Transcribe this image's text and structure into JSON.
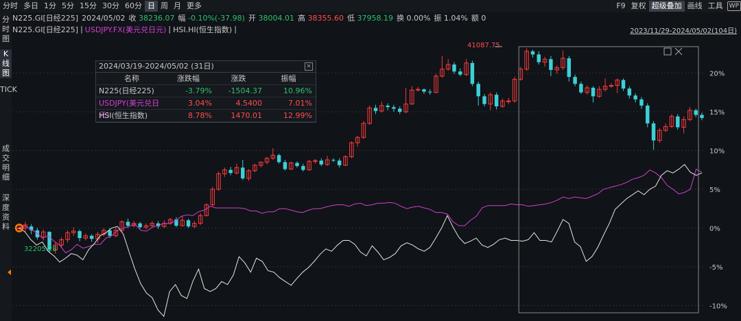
{
  "toolbar": {
    "periods": [
      "分时",
      "多日",
      "1分",
      "5分",
      "15分",
      "30分",
      "60分",
      "日",
      "周",
      "月",
      "更多"
    ],
    "active_period": "日",
    "tools": [
      "F9",
      "复权",
      "超级叠加",
      "画线",
      "工具"
    ],
    "active_tool": "超级叠加",
    "wp_label": "WP"
  },
  "quote": {
    "name": "N225.GI[日经225]",
    "date": "2024/05/02",
    "close_label": "收",
    "close": "38236.07",
    "change_label": "幅",
    "change": "-0.10%(-37.98)",
    "open_label": "开",
    "open": "38004.01",
    "high_label": "高",
    "high": "38355.60",
    "low_label": "低",
    "low": "37958.19",
    "turnover_label": "换",
    "turnover": "0.00%",
    "amplitude_label": "振",
    "amplitude": "1.04%",
    "amount_label": "额",
    "amount": "0"
  },
  "overlay": {
    "main": "N225.GI[日经225]",
    "sep1": "|",
    "usd": "USDJPY.FX(美元兑日元)",
    "sep2": "|",
    "hsi": "HSI.HI(恒生指数)",
    "sep3": "|",
    "range": "2023/11/29-2024/05/02(104日)"
  },
  "sidetabs": [
    "分时图",
    "K线图",
    "TICK",
    "成交明细",
    "深度资料"
  ],
  "active_sidetab": "K线图",
  "stats": {
    "title": "2024/03/19-2024/05/02 (31日)",
    "headers": [
      "名称",
      "涨跌幅",
      "涨跌",
      "振幅"
    ],
    "rows": [
      {
        "name": "N225(日经225)",
        "pct": "-3.79%",
        "chg": "-1504.37",
        "amp": "10.96%",
        "name_color": "#c8c8c8",
        "val_color": "#2dc26b"
      },
      {
        "name": "USDJPY(美元兑日元)",
        "pct": "3.04%",
        "chg": "4.5400",
        "amp": "7.01%",
        "name_color": "#d040d0",
        "val_color": "#ff4d4d"
      },
      {
        "name": "HSI(恒生指数)",
        "pct": "8.78%",
        "chg": "1470.01",
        "amp": "12.99%",
        "name_color": "#c8c8c8",
        "val_color": "#ff4d4d"
      }
    ]
  },
  "chart_data": {
    "type": "line",
    "annotations": {
      "high": "41087.75",
      "low": "32205.28"
    },
    "ylim": [
      -12,
      25
    ],
    "y_ticks": [
      -10,
      -5,
      0,
      5,
      10,
      15,
      20
    ],
    "y_tick_labels": [
      "-10%",
      "-5%",
      "0%",
      "5%",
      "10%",
      "15%",
      "20%"
    ],
    "candles": [
      [
        0,
        0,
        0.6,
        -0.4
      ],
      [
        0,
        0.4,
        0.8,
        -0.5
      ],
      [
        0.2,
        -0.3,
        0.5,
        -0.8
      ],
      [
        -0.3,
        -1.2,
        0,
        -1.5
      ],
      [
        -1.2,
        -0.5,
        -0.2,
        -1.6
      ],
      [
        -0.5,
        -2.8,
        -0.4,
        -3.2
      ],
      [
        -2.8,
        -2.2,
        -1.9,
        -3.3
      ],
      [
        -2.2,
        -1.5,
        -1.2,
        -2.6
      ],
      [
        -1.5,
        -0.6,
        -0.3,
        -1.9
      ],
      [
        -0.6,
        -0.4,
        0.1,
        -1.0
      ],
      [
        -0.4,
        -1.3,
        -0.2,
        -1.7
      ],
      [
        -1.3,
        -1.0,
        -0.7,
        -1.6
      ],
      [
        -1.0,
        -1.4,
        -0.8,
        -1.8
      ],
      [
        -1.4,
        -0.8,
        -0.5,
        -1.9
      ],
      [
        -0.8,
        -0.3,
        0,
        -1.1
      ],
      [
        -0.3,
        -1.0,
        0,
        -1.3
      ],
      [
        -1.0,
        -0.3,
        0.1,
        -1.2
      ],
      [
        -0.3,
        0.8,
        1.0,
        -0.5
      ],
      [
        0.8,
        0.3,
        1.2,
        0
      ],
      [
        0.3,
        0.6,
        0.9,
        0.1
      ],
      [
        0.6,
        0.1,
        0.8,
        -0.1
      ],
      [
        0.1,
        0.3,
        0.6,
        -0.2
      ],
      [
        0.3,
        0.6,
        0.9,
        0.1
      ],
      [
        0.6,
        0.2,
        0.9,
        -0.1
      ],
      [
        0.2,
        0.6,
        1.0,
        0
      ],
      [
        0.6,
        1.1,
        1.3,
        0.4
      ],
      [
        1.1,
        0.3,
        1.4,
        0.1
      ],
      [
        0.3,
        1.0,
        1.6,
        0.2
      ],
      [
        1.0,
        0.2,
        1.2,
        0
      ],
      [
        0.2,
        0.6,
        0.9,
        0
      ],
      [
        0.6,
        1.6,
        1.9,
        0.4
      ],
      [
        1.6,
        3.0,
        3.2,
        1.5
      ],
      [
        3.0,
        5.0,
        5.3,
        2.8
      ],
      [
        5.0,
        7.0,
        7.3,
        4.8
      ],
      [
        7.0,
        7.5,
        7.8,
        6.6
      ],
      [
        7.5,
        7.1,
        7.9,
        6.8
      ],
      [
        7.1,
        7.8,
        8.3,
        6.9
      ],
      [
        7.8,
        6.4,
        8.8,
        6.2
      ],
      [
        6.4,
        7.4,
        7.6,
        6.1
      ],
      [
        7.4,
        8.1,
        8.3,
        7.2
      ],
      [
        8.1,
        8.5,
        8.6,
        7.8
      ],
      [
        8.5,
        9.0,
        9.2,
        8.2
      ],
      [
        9.0,
        9.4,
        10.3,
        8.8
      ],
      [
        9.4,
        8.5,
        9.6,
        8.3
      ],
      [
        8.5,
        7.6,
        8.8,
        7.4
      ],
      [
        7.6,
        8.4,
        8.6,
        7.5
      ],
      [
        8.4,
        8.0,
        8.6,
        7.8
      ],
      [
        8.0,
        7.5,
        8.3,
        7.3
      ],
      [
        7.5,
        8.6,
        8.8,
        7.4
      ],
      [
        8.6,
        8.7,
        8.9,
        8.3
      ],
      [
        8.7,
        8.2,
        9.0,
        8.0
      ],
      [
        8.2,
        8.8,
        9.3,
        8.0
      ],
      [
        8.8,
        8.7,
        9.0,
        8.5
      ],
      [
        8.7,
        8.1,
        9.0,
        7.8
      ],
      [
        8.1,
        9.2,
        9.4,
        8.0
      ],
      [
        9.2,
        11.0,
        11.2,
        9.0
      ],
      [
        11.0,
        11.7,
        11.9,
        10.5
      ],
      [
        11.7,
        13.5,
        13.8,
        11.5
      ],
      [
        13.5,
        15.5,
        15.8,
        13.3
      ],
      [
        15.5,
        15.1,
        15.9,
        14.7
      ],
      [
        15.1,
        15.8,
        16.3,
        14.9
      ],
      [
        15.8,
        15.6,
        16.1,
        15.2
      ],
      [
        15.6,
        15.4,
        15.9,
        15.0
      ],
      [
        15.4,
        15.0,
        15.7,
        14.7
      ],
      [
        15.0,
        16.0,
        18.1,
        14.8
      ],
      [
        16.0,
        17.8,
        18.3,
        15.9
      ],
      [
        17.8,
        17.9,
        18.2,
        17.6
      ],
      [
        17.9,
        17.6,
        18.0,
        17.3
      ],
      [
        17.6,
        17.5,
        17.9,
        17.2
      ],
      [
        17.5,
        19.6,
        19.9,
        17.4
      ],
      [
        19.6,
        20.5,
        22.2,
        19.4
      ],
      [
        20.5,
        21.1,
        21.8,
        20.3
      ],
      [
        21.1,
        20.2,
        21.4,
        19.9
      ],
      [
        20.2,
        19.8,
        20.6,
        19.6
      ],
      [
        19.8,
        21.3,
        21.8,
        19.6
      ],
      [
        21.3,
        18.6,
        21.6,
        18.3
      ],
      [
        18.6,
        17.0,
        18.9,
        15.8
      ],
      [
        17.0,
        16.0,
        17.3,
        15.7
      ],
      [
        16.0,
        17.2,
        17.5,
        15.2
      ],
      [
        17.2,
        15.7,
        17.5,
        15.3
      ],
      [
        15.7,
        16.4,
        16.7,
        15.5
      ],
      [
        16.4,
        16.4,
        16.8,
        16.0
      ],
      [
        16.4,
        19.2,
        19.5,
        16.2
      ],
      [
        19.2,
        20.5,
        20.8,
        19.0
      ],
      [
        20.5,
        22.8,
        23.2,
        20.3
      ],
      [
        22.8,
        22.4,
        23.0,
        22.0
      ],
      [
        22.4,
        21.4,
        22.8,
        21.1
      ],
      [
        21.4,
        21.8,
        22.1,
        20.8
      ],
      [
        21.8,
        20.4,
        22.2,
        19.6
      ],
      [
        20.4,
        20.7,
        21.0,
        19.9
      ],
      [
        20.7,
        21.9,
        22.9,
        20.4
      ],
      [
        21.9,
        19.5,
        22.2,
        18.9
      ],
      [
        19.5,
        18.6,
        19.8,
        18.3
      ],
      [
        18.6,
        17.5,
        18.9,
        17.3
      ],
      [
        17.5,
        18.1,
        18.4,
        17.2
      ],
      [
        18.1,
        17.0,
        18.3,
        16.2
      ],
      [
        17.0,
        17.9,
        18.3,
        16.8
      ],
      [
        17.9,
        18.3,
        19.3,
        17.6
      ],
      [
        18.3,
        18.4,
        18.7,
        18.1
      ],
      [
        18.4,
        19.1,
        19.3,
        17.4
      ],
      [
        19.1,
        18.0,
        19.3,
        17.7
      ],
      [
        18.0,
        17.1,
        18.3,
        16.7
      ],
      [
        17.1,
        16.6,
        17.4,
        16.2
      ],
      [
        16.6,
        15.8,
        16.9,
        15.4
      ],
      [
        15.8,
        13.5,
        16.1,
        13.0
      ],
      [
        13.5,
        11.3,
        13.8,
        10.1
      ],
      [
        11.3,
        12.6,
        12.9,
        11.0
      ],
      [
        12.6,
        13.1,
        13.5,
        12.4
      ],
      [
        13.1,
        14.4,
        14.7,
        12.9
      ],
      [
        14.4,
        13.0,
        14.7,
        12.7
      ],
      [
        13.0,
        14.0,
        14.4,
        12.2
      ],
      [
        14.0,
        15.2,
        15.6,
        13.8
      ],
      [
        15.2,
        14.6,
        15.4,
        14.3
      ],
      [
        14.6,
        14.2,
        14.9,
        13.9
      ]
    ],
    "series": [
      {
        "name": "USDJPY.FX(美元兑日元)",
        "color": "#d040d0",
        "values": [
          0,
          0.3,
          -0.2,
          -0.6,
          -1.3,
          -1.0,
          -1.7,
          -2.2,
          -3.2,
          -2.8,
          -2.1,
          -2.6,
          -2.4,
          -2.1,
          -2.1,
          -1.3,
          -1.0,
          -0.3,
          0,
          0.2,
          0.5,
          -0.3,
          -0.4,
          0.1,
          0.3,
          0.6,
          0.6,
          0.9,
          1.5,
          1.7,
          1.6,
          2.1,
          2.3,
          2.8,
          2.6,
          2.6,
          2.6,
          2.6,
          2.6,
          2.5,
          2.2,
          2.2,
          1.9,
          2.1,
          2.1,
          2.5,
          2.5,
          2.3,
          2.1,
          2.0,
          2.3,
          2.5,
          2.5,
          2.7,
          2.9,
          3.0,
          3.0,
          2.8,
          3.1,
          3.2,
          2.9,
          3.0,
          3.2,
          3.2,
          3.3,
          3.2,
          2.8,
          2.5,
          2.7,
          2.8,
          2.6,
          2.4,
          2.0,
          2.0,
          1.8,
          0.8,
          0.3,
          0.3,
          1.0,
          1.5,
          2.6,
          2.9,
          2.9,
          2.9,
          2.9,
          3.1,
          3.0,
          3.0,
          2.8,
          2.9,
          3.0,
          3.1,
          3.3,
          3.6,
          4.0,
          3.8,
          4.0,
          3.9,
          3.8,
          4.1,
          4.4,
          5.0,
          5.2,
          5.4,
          5.6,
          5.9,
          6.3,
          6.5,
          6.8,
          7.5,
          7.1,
          6.5,
          5.5,
          5.0,
          4.4,
          4.6,
          5.0,
          7.6,
          7.2
        ]
      },
      {
        "name": "HSI.HI(恒生指数)",
        "color": "#e6e6e6",
        "values": [
          0,
          -0.5,
          -1.5,
          -2.2,
          -1.8,
          -3.0,
          -3.6,
          -4.4,
          -3.9,
          -3.3,
          -3.5,
          -4.1,
          -2.8,
          -2.0,
          -1.0,
          -0.6,
          0,
          0.2,
          -0.8,
          -3.1,
          -5.3,
          -7.2,
          -8.4,
          -9.0,
          -10.6,
          -11.4,
          -8.2,
          -7.3,
          -8.7,
          -9.1,
          -6.9,
          -5.3,
          -7.8,
          -8.2,
          -7.8,
          -6.9,
          -7.3,
          -6.1,
          -3.7,
          -4.5,
          -5.7,
          -3.9,
          -4.3,
          -5.5,
          -5.7,
          -6.4,
          -6.9,
          -7.4,
          -6.5,
          -5.7,
          -5.1,
          -4.3,
          -3.4,
          -2.7,
          -3.0,
          -2.2,
          -1.6,
          -1.6,
          -2.1,
          -3.1,
          -3.6,
          -2.3,
          -3.1,
          -4.1,
          -3.8,
          -3.3,
          -2.3,
          -1.9,
          -2.2,
          -2.7,
          -3.0,
          -2.5,
          -1.3,
          0,
          1.6,
          0.1,
          -1.2,
          -2.0,
          -1.7,
          -1.3,
          -2.2,
          -2.5,
          -2.1,
          -1.5,
          -1.3,
          -1.6,
          -1.6,
          -1.7,
          -1.5,
          -0.6,
          -1.6,
          -1.6,
          -1.8,
          -0.4,
          1.1,
          0.6,
          -1.8,
          -2.4,
          -4.3,
          -3.7,
          -2.5,
          -0.9,
          0.6,
          2.4,
          3.1,
          3.8,
          4.3,
          4.8,
          4.3,
          5.0,
          5.4,
          6.8,
          7.4,
          7.1,
          7.6,
          8.2,
          7.2,
          6.8,
          7.1
        ]
      }
    ]
  }
}
